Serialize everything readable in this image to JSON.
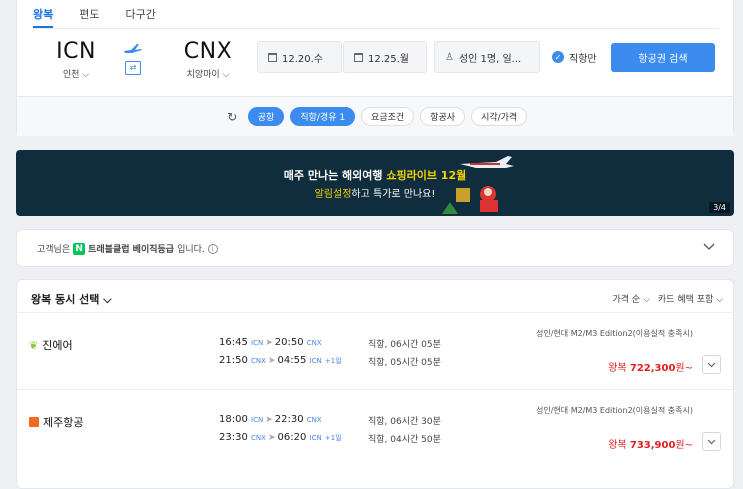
{
  "tabs": [
    {
      "label": "왕복",
      "active": true
    },
    {
      "label": "편도",
      "active": false
    },
    {
      "label": "다구간",
      "active": false
    }
  ],
  "origin": {
    "code": "ICN",
    "city": "인천"
  },
  "destination": {
    "code": "CNX",
    "city": "치앙마이"
  },
  "dates": {
    "depart": "12.20.수",
    "return": "12.25.월"
  },
  "passengers": "성인 1명, 일...",
  "direct_only": "직항만",
  "search_button": "항공권 검색",
  "filters": [
    {
      "label": "공항",
      "active": true
    },
    {
      "label": "직항/경유 1",
      "active": true
    },
    {
      "label": "요금조건",
      "active": false
    },
    {
      "label": "항공사",
      "active": false
    },
    {
      "label": "시각/가격",
      "active": false
    }
  ],
  "banner": {
    "line1_prefix": "매주 만나는 해외여행 ",
    "line1_highlight": "쇼핑라이브 12월",
    "line2_highlight": "알림설정",
    "line2_suffix": "하고 특가로 만나요!",
    "pager": "3/4"
  },
  "membership": {
    "prefix": "고객님은",
    "badge": "N",
    "grade": "트래블클럽 베이직등급",
    "suffix": "입니다."
  },
  "results": {
    "header": "왕복 동시 선택",
    "sort": "가격 순",
    "card_benefit": "카드 혜택 포함",
    "flights": [
      {
        "airline": "진에어",
        "out": {
          "dep": "16:45",
          "dep_ap": "ICN",
          "arr": "20:50",
          "arr_ap": "CNX",
          "plus": "",
          "dur": "직항, 06시간 05분"
        },
        "ret": {
          "dep": "21:50",
          "dep_ap": "CNX",
          "arr": "04:55",
          "arr_ap": "ICN",
          "plus": "+1일",
          "dur": "직항, 05시간 05분"
        },
        "fare": "성인/현대 M2/M3 Edition2(이용실적 충족시)",
        "price_label": "왕복",
        "price": "722,300",
        "price_suffix": "원~"
      },
      {
        "airline": "제주항공",
        "out": {
          "dep": "18:00",
          "dep_ap": "ICN",
          "arr": "22:30",
          "arr_ap": "CNX",
          "plus": "",
          "dur": "직항, 06시간 30분"
        },
        "ret": {
          "dep": "23:30",
          "dep_ap": "CNX",
          "arr": "06:20",
          "arr_ap": "ICN",
          "plus": "+1일",
          "dur": "직항, 04시간 50분"
        },
        "fare": "성인/현대 M2/M3 Edition2(이용실적 충족시)",
        "price_label": "왕복",
        "price": "733,900",
        "price_suffix": "원~"
      }
    ]
  },
  "colors": {
    "accent": "#3c8cf0",
    "price": "#e02020",
    "banner_bg": "#0f2d3d",
    "highlight": "#f5d200",
    "naver": "#03c75a"
  }
}
